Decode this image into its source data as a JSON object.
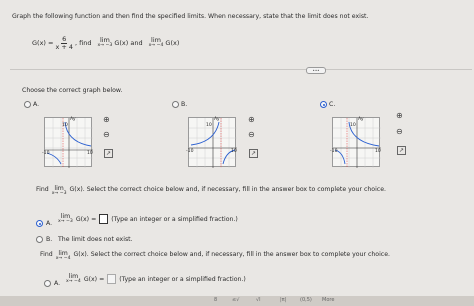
{
  "question": {
    "instruction": "Graph the following function and then find the specified limits. When necessary, state that the limit does not exist.",
    "function_lhs": "G(x) =",
    "function_num": "6",
    "function_den": "x + 4",
    "find": ", find",
    "lim_word": "lim",
    "lim1_sub": "x→ −3",
    "lim1_expr": "G(x) and",
    "lim2_sub": "x→ −4",
    "lim2_expr": "G(x)",
    "more_label": "•••"
  },
  "graph_section": {
    "prompt": "Choose the correct graph below.",
    "options": [
      {
        "label": "A.",
        "selected": false,
        "axis_y": "Ay",
        "tick_top": "10",
        "tick_left": "-10",
        "tick_right": "10"
      },
      {
        "label": "B.",
        "selected": false,
        "axis_y": "Ay",
        "tick_top": "10",
        "tick_left": "-10",
        "tick_right": "10"
      },
      {
        "label": "C.",
        "selected": true,
        "axis_y": "Ay",
        "tick_top": "10",
        "tick_left": "-10",
        "tick_right": "10"
      }
    ]
  },
  "part1": {
    "find": "Find",
    "lim_word": "lim",
    "lim_sub": "x→ −3",
    "tail": "G(x). Select the correct choice below and, if necessary, fill in the answer box to complete your choice.",
    "choice_a_label": "A.",
    "choice_a_expr": "G(x) =",
    "choice_a_hint": "(Type an integer or a simplified fraction.)",
    "choice_b_label": "B.",
    "choice_b_text": "The limit does not exist."
  },
  "part2": {
    "find": "Find",
    "lim_word": "lim",
    "lim_sub": "x→ −4",
    "tail": "G(x). Select the correct choice below and, if necessary, fill in the answer box to complete your choice.",
    "choice_a_label": "A.",
    "choice_a_expr": "G(x) =",
    "choice_a_hint": "(Type an integer or a simplified fraction.)"
  },
  "footer": [
    "8",
    "≤√",
    "√l",
    "|π|",
    "(0,5)",
    "More"
  ],
  "colors": {
    "accent": "#2a5fd0",
    "curve": "#2a5fd0",
    "asymptote": "#d33"
  }
}
